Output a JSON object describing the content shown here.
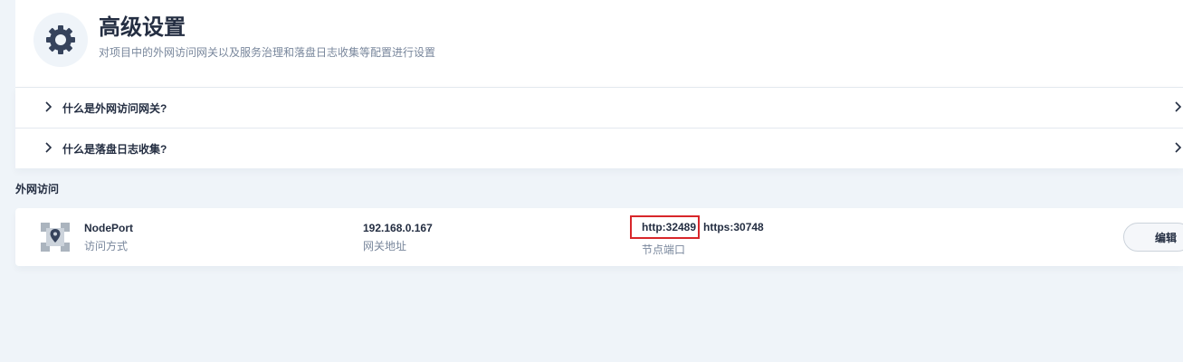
{
  "header": {
    "title": "高级设置",
    "description": "对项目中的外网访问网关以及服务治理和落盘日志收集等配置进行设置",
    "icon": "gear-icon"
  },
  "faq": [
    {
      "label": "什么是外网访问网关?"
    },
    {
      "label": "什么是落盘日志收集?"
    }
  ],
  "gateway_section": {
    "title": "外网访问",
    "access_mode": {
      "value": "NodePort",
      "label": "访问方式"
    },
    "address": {
      "value": "192.168.0.167",
      "label": "网关地址"
    },
    "ports": {
      "http": "http:32489",
      "https": "https:30748",
      "label": "节点端口"
    },
    "edit_label": "编辑",
    "icon": "gateway-icon"
  },
  "colors": {
    "background": "#eff4f9",
    "text_primary": "#242e42",
    "text_secondary": "#79879c",
    "highlight": "#d8262a"
  }
}
